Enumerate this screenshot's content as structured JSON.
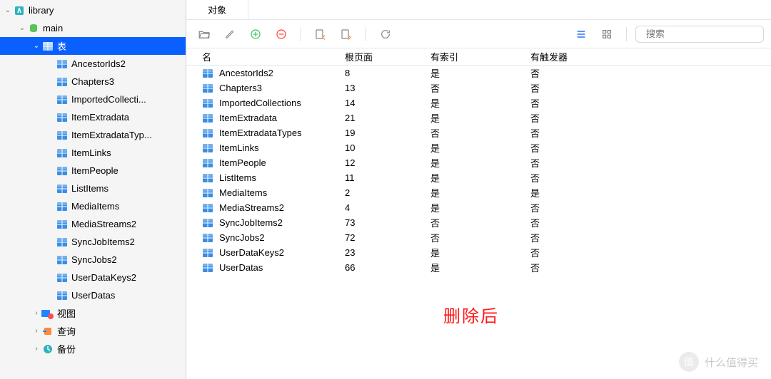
{
  "sidebar": {
    "library_label": "library",
    "main_label": "main",
    "tables_label": "表",
    "views_label": "视图",
    "query_label": "查询",
    "backup_label": "备份",
    "tables": [
      "AncestorIds2",
      "Chapters3",
      "ImportedCollecti...",
      "ItemExtradata",
      "ItemExtradataTyp...",
      "ItemLinks",
      "ItemPeople",
      "ListItems",
      "MediaItems",
      "MediaStreams2",
      "SyncJobItems2",
      "SyncJobs2",
      "UserDataKeys2",
      "UserDatas"
    ]
  },
  "tabs": {
    "objects": "对象"
  },
  "search": {
    "placeholder": "搜索"
  },
  "table_header": {
    "name": "名",
    "root_page": "根页面",
    "has_index": "有索引",
    "has_trigger": "有触发器"
  },
  "rows": [
    {
      "name": "AncestorIds2",
      "root": "8",
      "index": "是",
      "trigger": "否"
    },
    {
      "name": "Chapters3",
      "root": "13",
      "index": "否",
      "trigger": "否"
    },
    {
      "name": "ImportedCollections",
      "root": "14",
      "index": "是",
      "trigger": "否"
    },
    {
      "name": "ItemExtradata",
      "root": "21",
      "index": "是",
      "trigger": "否"
    },
    {
      "name": "ItemExtradataTypes",
      "root": "19",
      "index": "否",
      "trigger": "否"
    },
    {
      "name": "ItemLinks",
      "root": "10",
      "index": "是",
      "trigger": "否"
    },
    {
      "name": "ItemPeople",
      "root": "12",
      "index": "是",
      "trigger": "否"
    },
    {
      "name": "ListItems",
      "root": "11",
      "index": "是",
      "trigger": "否"
    },
    {
      "name": "MediaItems",
      "root": "2",
      "index": "是",
      "trigger": "是"
    },
    {
      "name": "MediaStreams2",
      "root": "4",
      "index": "是",
      "trigger": "否"
    },
    {
      "name": "SyncJobItems2",
      "root": "73",
      "index": "否",
      "trigger": "否"
    },
    {
      "name": "SyncJobs2",
      "root": "72",
      "index": "否",
      "trigger": "否"
    },
    {
      "name": "UserDataKeys2",
      "root": "23",
      "index": "是",
      "trigger": "否"
    },
    {
      "name": "UserDatas",
      "root": "66",
      "index": "是",
      "trigger": "否"
    }
  ],
  "annotation": "删除后",
  "watermark": {
    "badge": "值",
    "text": "什么值得买"
  }
}
